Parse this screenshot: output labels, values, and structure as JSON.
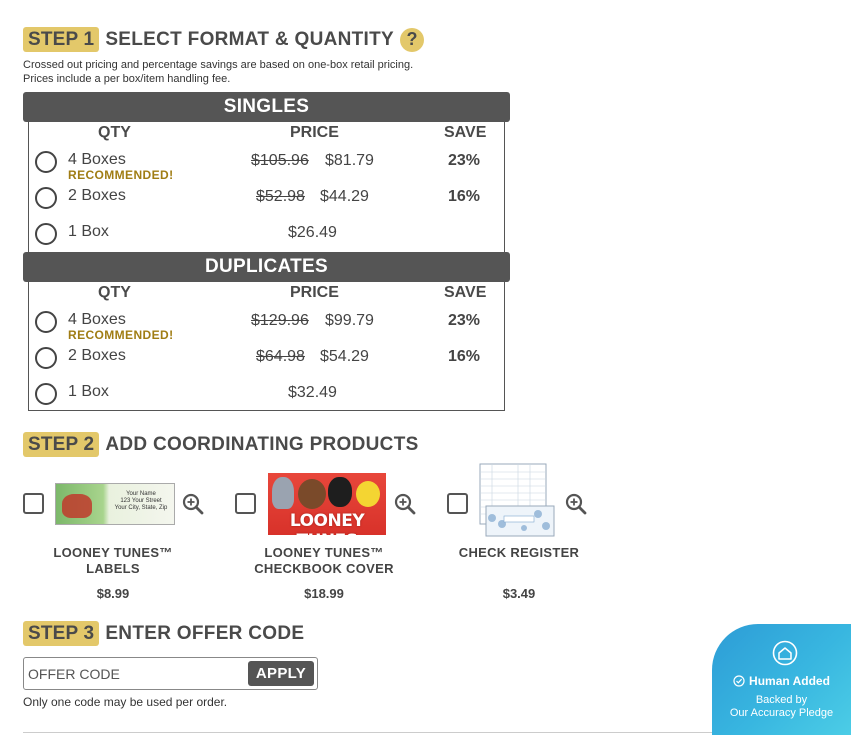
{
  "step1": {
    "badge": "STEP 1",
    "title": "SELECT FORMAT & QUANTITY",
    "help": "?",
    "note_line1": "Crossed out pricing and percentage savings are based on one-box retail pricing.",
    "note_line2": "Prices include a per box/item handling fee."
  },
  "columns": {
    "qty": "QTY",
    "price": "PRICE",
    "save": "SAVE"
  },
  "singles": {
    "title": "SINGLES",
    "options": [
      {
        "qty": "4 Boxes",
        "recommended": "RECOMMENDED!",
        "old_price": "$105.96",
        "price": "$81.79",
        "save": "23%"
      },
      {
        "qty": "2 Boxes",
        "old_price": "$52.98",
        "price": "$44.29",
        "save": "16%"
      },
      {
        "qty": "1 Box",
        "price": "$26.49"
      }
    ]
  },
  "duplicates": {
    "title": "DUPLICATES",
    "options": [
      {
        "qty": "4 Boxes",
        "recommended": "RECOMMENDED!",
        "old_price": "$129.96",
        "price": "$99.79",
        "save": "23%"
      },
      {
        "qty": "2 Boxes",
        "old_price": "$64.98",
        "price": "$54.29",
        "save": "16%"
      },
      {
        "qty": "1 Box",
        "price": "$32.49"
      }
    ]
  },
  "step2": {
    "badge": "STEP 2",
    "title": "ADD COORDINATING PRODUCTS",
    "products": [
      {
        "name_line1": "LOONEY TUNES™",
        "name_line2": "LABELS",
        "price": "$8.99",
        "label_text": [
          "Your Name",
          "123 Your Street",
          "Your City, State, Zip"
        ]
      },
      {
        "name_line1": "LOONEY TUNES™",
        "name_line2": "CHECKBOOK COVER",
        "price": "$18.99",
        "cover_text": "LOONEY TUNES"
      },
      {
        "name_line1": "CHECK REGISTER",
        "name_line2": "",
        "price": "$3.49"
      }
    ]
  },
  "step3": {
    "badge": "STEP 3",
    "title": "ENTER OFFER CODE",
    "placeholder": "OFFER CODE",
    "apply": "APPLY",
    "note": "Only one code may be used per order."
  },
  "pledge": {
    "title": "Human Added",
    "line1": "Backed by",
    "line2": "Our Accuracy Pledge"
  },
  "colors": {
    "gold": "#e3c86a",
    "dark": "#555555",
    "recommended": "#a07d14",
    "pledge": "#38b6e0"
  }
}
